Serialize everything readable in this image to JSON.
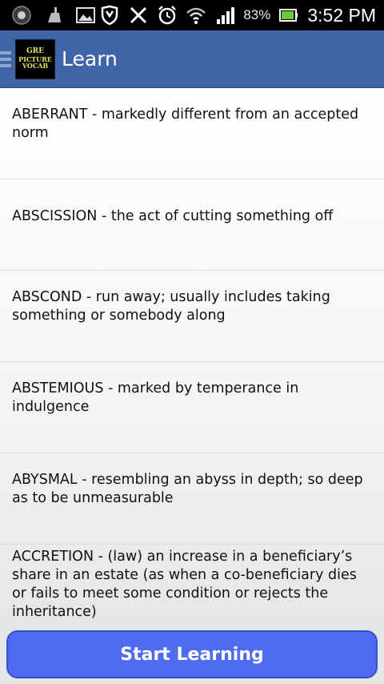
{
  "status_bar": {
    "icons": [
      "notification-circle-icon",
      "cleaner-icon",
      "image-icon",
      "shield-icon",
      "tools-icon",
      "alarm-icon",
      "wifi-icon",
      "signal-icon",
      "battery-icon"
    ],
    "battery_percent": "83%",
    "time": "3:52 PM"
  },
  "action_bar": {
    "logo_lines": [
      "GRE",
      "PICTURE",
      "VOCAB"
    ],
    "title": "Learn"
  },
  "words": [
    {
      "text": "ABERRANT - markedly different from an accepted norm"
    },
    {
      "text": "ABSCISSION - the act of cutting something off"
    },
    {
      "text": "ABSCOND - run away; usually includes taking something or somebody along"
    },
    {
      "text": "ABSTEMIOUS - marked by temperance in indulgence"
    },
    {
      "text": "ABYSMAL - resembling an abyss in depth; so deep as to be unmeasurable"
    },
    {
      "text": "ACCRETION - (law) an increase in a beneficiary’s share in an estate (as when a co-beneficiary dies or fails to meet some condition or rejects the inheritance)"
    }
  ],
  "start_button": {
    "label": "Start Learning"
  },
  "colors": {
    "action_bar": "#3f64a8",
    "button": "#4d6cf2",
    "logo_text": "#e9e35a"
  }
}
